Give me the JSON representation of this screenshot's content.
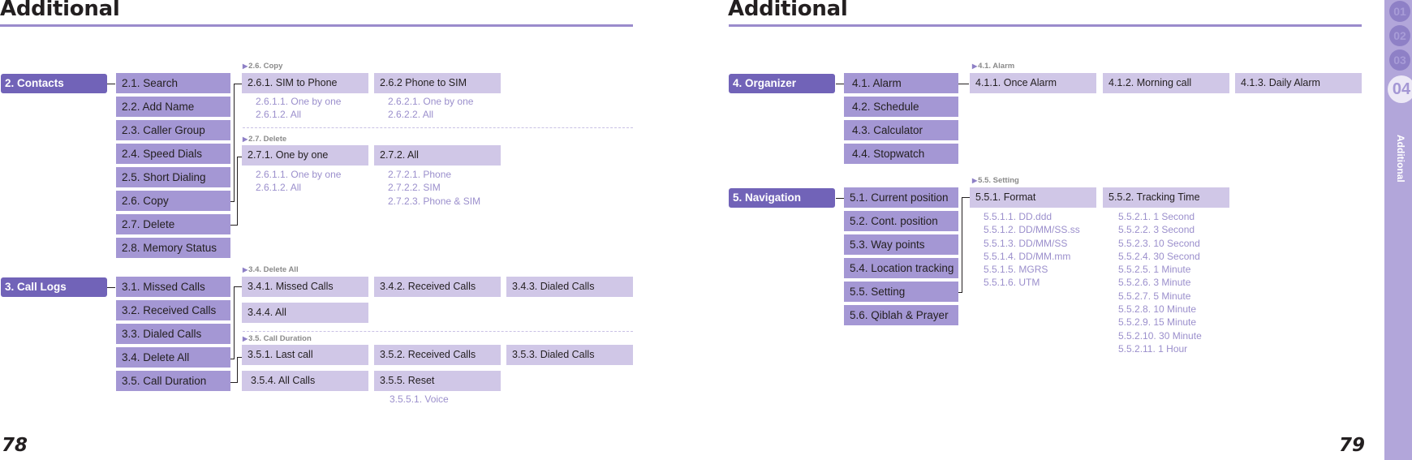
{
  "left_page": {
    "title": "Additional",
    "page_number": "78",
    "contacts": {
      "root": "2. Contacts",
      "items": [
        "2.1. Search",
        "2.2. Add Name",
        "2.3. Caller Group",
        "2.4. Speed Dials",
        "2.5. Short Dialing",
        "2.6. Copy",
        "2.7. Delete",
        "2.8. Memory Status"
      ],
      "copy": {
        "label": "2.6. Copy",
        "options": [
          {
            "label": "2.6.1. SIM to Phone",
            "subs": [
              "2.6.1.1. One by one",
              "2.6.1.2. All"
            ]
          },
          {
            "label": "2.6.2 Phone to SIM",
            "subs": [
              "2.6.2.1. One by one",
              "2.6.2.2. All"
            ]
          }
        ]
      },
      "delete": {
        "label": "2.7. Delete",
        "options": [
          {
            "label": "2.7.1. One by one",
            "subs": [
              "2.6.1.1. One by one",
              "2.6.1.2. All"
            ]
          },
          {
            "label": "2.7.2. All",
            "subs": [
              "2.7.2.1. Phone",
              "2.7.2.2. SIM",
              "2.7.2.3. Phone & SIM"
            ]
          }
        ]
      }
    },
    "call_logs": {
      "root": "3. Call Logs",
      "items": [
        "3.1. Missed Calls",
        "3.2. Received Calls",
        "3.3. Dialed Calls",
        "3.4. Delete All",
        "3.5. Call Duration"
      ],
      "delete_all": {
        "label": "3.4. Delete All",
        "options": [
          "3.4.1. Missed Calls",
          "3.4.2. Received Calls",
          "3.4.3. Dialed Calls",
          "3.4.4. All"
        ]
      },
      "call_duration": {
        "label": "3.5. Call Duration",
        "options": [
          "3.5.1. Last call",
          "3.5.2. Received Calls",
          "3.5.3. Dialed Calls",
          "3.5.4. All Calls",
          "3.5.5. Reset"
        ],
        "reset_subs": [
          "3.5.5.1. Voice"
        ]
      }
    }
  },
  "right_page": {
    "title": "Additional",
    "page_number": "79",
    "organizer": {
      "root": "4. Organizer",
      "items": [
        "4.1. Alarm",
        "4.2. Schedule",
        "4.3. Calculator",
        "4.4. Stopwatch"
      ],
      "alarm": {
        "label": "4.1. Alarm",
        "options": [
          "4.1.1. Once Alarm",
          "4.1.2. Morning call",
          "4.1.3. Daily Alarm"
        ]
      }
    },
    "navigation": {
      "root": "5. Navigation",
      "items": [
        "5.1. Current position",
        "5.2. Cont. position",
        "5.3. Way points",
        "5.4. Location tracking",
        "5.5. Setting",
        "5.6. Qiblah & Prayer"
      ],
      "setting": {
        "label": "5.5. Setting",
        "options": [
          {
            "label": "5.5.1. Format",
            "subs": [
              "5.5.1.1. DD.ddd",
              "5.5.1.2. DD/MM/SS.ss",
              "5.5.1.3. DD/MM/SS",
              "5.5.1.4. DD/MM.mm",
              "5.5.1.5. MGRS",
              "5.5.1.6. UTM"
            ]
          },
          {
            "label": "5.5.2. Tracking Time",
            "subs": [
              "5.5.2.1. 1 Second",
              "5.5.2.2. 3 Second",
              "5.5.2.3. 10 Second",
              "5.5.2.4. 30 Second",
              "5.5.2.5. 1 Minute",
              "5.5.2.6. 3 Minute",
              "5.5.2.7. 5 Minute",
              "5.5.2.8. 10 Minute",
              "5.5.2.9. 15 Minute",
              "5.5.2.10. 30 Minute",
              "5.5.2.11. 1 Hour"
            ]
          }
        ]
      }
    }
  },
  "side_tabs": {
    "chapters": [
      "01",
      "02",
      "03",
      "04"
    ],
    "active": "04",
    "active_label": "Additional"
  },
  "colors": {
    "root_box": "#7163b8",
    "level1_box": "#a497d4",
    "level2_box": "#d0c7e7",
    "sub_text": "#9b8fcc",
    "title_rule": "#9a8bcc",
    "side_tab": "#b2a6da"
  }
}
